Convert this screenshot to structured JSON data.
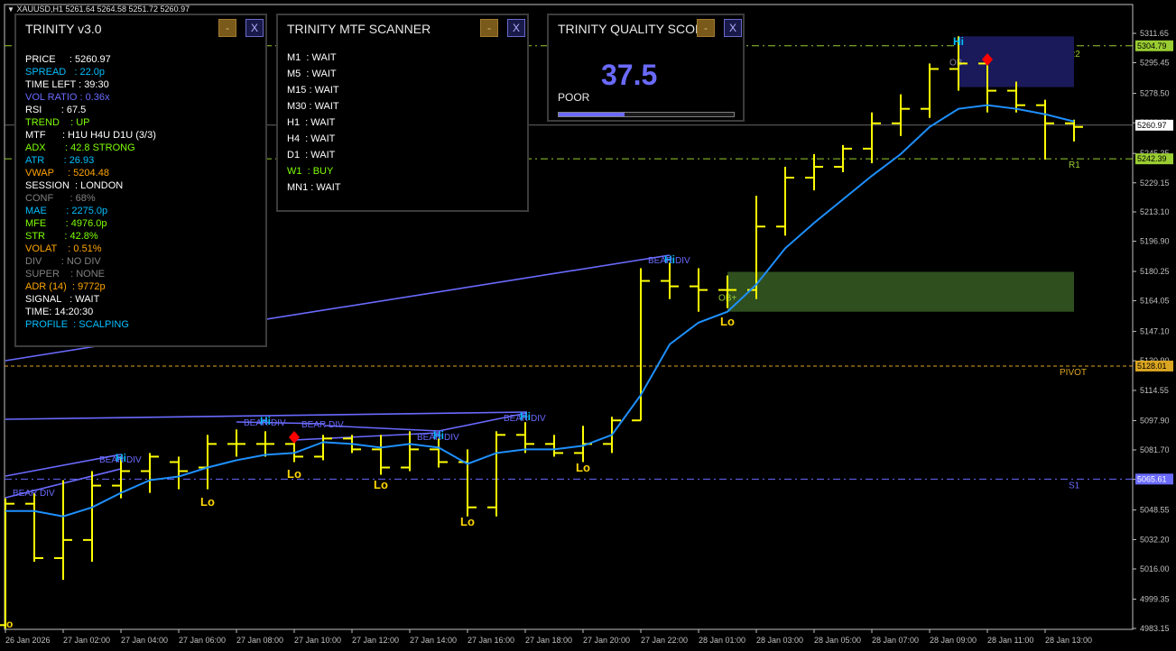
{
  "symbol_header": "XAUUSD,H1  5261.64 5264.58 5251.72 5260.97",
  "colors": {
    "candle": "#ffff00",
    "ema": "#1e90ff",
    "div_line": "#6a6aff",
    "pivot": "#daa520",
    "r_line": "#9acd32",
    "s_line": "#6a6aff",
    "ob_plus": "#2f4f1f",
    "ob_minus": "#1a1a5a",
    "hi_label": "#00bfff",
    "lo_label": "#ffd700",
    "marker": "#ff0000"
  },
  "price_axis": {
    "labels": [
      "5311.65",
      "5295.45",
      "5278.50",
      "5262.30",
      "5245.35",
      "5229.15",
      "5213.10",
      "5196.90",
      "5180.25",
      "5164.05",
      "5147.10",
      "5130.90",
      "5114.55",
      "5097.90",
      "5081.70",
      "5065.50",
      "5048.55",
      "5032.20",
      "5016.00",
      "4999.35",
      "4983.15"
    ],
    "current_price": "5260.97",
    "r2_price": "5304.79",
    "r1_price": "5242.39",
    "pivot_price": "5128.01",
    "s1_price": "5065.61"
  },
  "time_axis": [
    "26 Jan 2026",
    "27 Jan 02:00",
    "27 Jan 04:00",
    "27 Jan 06:00",
    "27 Jan 08:00",
    "27 Jan 10:00",
    "27 Jan 12:00",
    "27 Jan 14:00",
    "27 Jan 16:00",
    "27 Jan 18:00",
    "27 Jan 20:00",
    "27 Jan 22:00",
    "28 Jan 01:00",
    "28 Jan 03:00",
    "28 Jan 05:00",
    "28 Jan 07:00",
    "28 Jan 09:00",
    "28 Jan 11:00",
    "28 Jan 13:00"
  ],
  "levels": {
    "r2": "R2",
    "r1": "R1",
    "pivot": "PIVOT",
    "s1": "S1"
  },
  "chart_labels": {
    "hi": "Hi",
    "lo": "Lo",
    "bear_div": "BEAR DIV",
    "ob_plus": "OB+",
    "ob_minus": "OB-",
    "lo_edge": "o"
  },
  "trinity_panel": {
    "title": "TRINITY v3.0",
    "min_btn": "-",
    "close_btn": "X",
    "rows": [
      {
        "text": "PRICE     : 5260.97",
        "color": "#ffffff"
      },
      {
        "text": "SPREAD   : 22.0p",
        "color": "#00bfff"
      },
      {
        "text": "TIME LEFT : 39:30",
        "color": "#ffffff"
      },
      {
        "text": "VOL RATIO : 0.36x",
        "color": "#6a6aff"
      },
      {
        "text": "RSI       : 67.5",
        "color": "#ffffff"
      },
      {
        "text": "TREND    : UP",
        "color": "#7fff00"
      },
      {
        "text": "MTF      : H1U H4U D1U (3/3)",
        "color": "#ffffff"
      },
      {
        "text": "ADX       : 42.8 STRONG",
        "color": "#7fff00"
      },
      {
        "text": "ATR       : 26.93",
        "color": "#00bfff"
      },
      {
        "text": "VWAP     : 5204.48",
        "color": "#ffa500"
      },
      {
        "text": "SESSION  : LONDON",
        "color": "#ffffff"
      },
      {
        "text": "CONF      : 68%",
        "color": "#808080"
      },
      {
        "text": "MAE       : 2275.0p",
        "color": "#00bfff"
      },
      {
        "text": "MFE       : 4976.0p",
        "color": "#7fff00"
      },
      {
        "text": "STR       : 42.8%",
        "color": "#7fff00"
      },
      {
        "text": "VOLAT    : 0.51%",
        "color": "#ffa500"
      },
      {
        "text": "DIV       : NO DIV",
        "color": "#808080"
      },
      {
        "text": "SUPER    : NONE",
        "color": "#808080"
      },
      {
        "text": "ADR (14)  : 9772p",
        "color": "#ffa500"
      },
      {
        "text": "SIGNAL   : WAIT",
        "color": "#ffffff"
      },
      {
        "text": "TIME: 14:20:30",
        "color": "#ffffff"
      },
      {
        "text": "PROFILE  : SCALPING",
        "color": "#00bfff"
      }
    ]
  },
  "mtf_panel": {
    "title": "TRINITY MTF SCANNER",
    "min_btn": "-",
    "close_btn": "X",
    "rows": [
      {
        "text": "M1  : WAIT",
        "color": "#ffffff"
      },
      {
        "text": "M5  : WAIT",
        "color": "#ffffff"
      },
      {
        "text": "M15 : WAIT",
        "color": "#ffffff"
      },
      {
        "text": "M30 : WAIT",
        "color": "#ffffff"
      },
      {
        "text": "H1  : WAIT",
        "color": "#ffffff"
      },
      {
        "text": "H4  : WAIT",
        "color": "#ffffff"
      },
      {
        "text": "D1  : WAIT",
        "color": "#ffffff"
      },
      {
        "text": "W1  : BUY",
        "color": "#7fff00"
      },
      {
        "text": "MN1 : WAIT",
        "color": "#ffffff"
      }
    ]
  },
  "quality_panel": {
    "title": "TRINITY QUALITY SCORE",
    "min_btn": "-",
    "close_btn": "X",
    "score": "37.5",
    "rating": "POOR",
    "progress_fraction": 0.375
  }
}
